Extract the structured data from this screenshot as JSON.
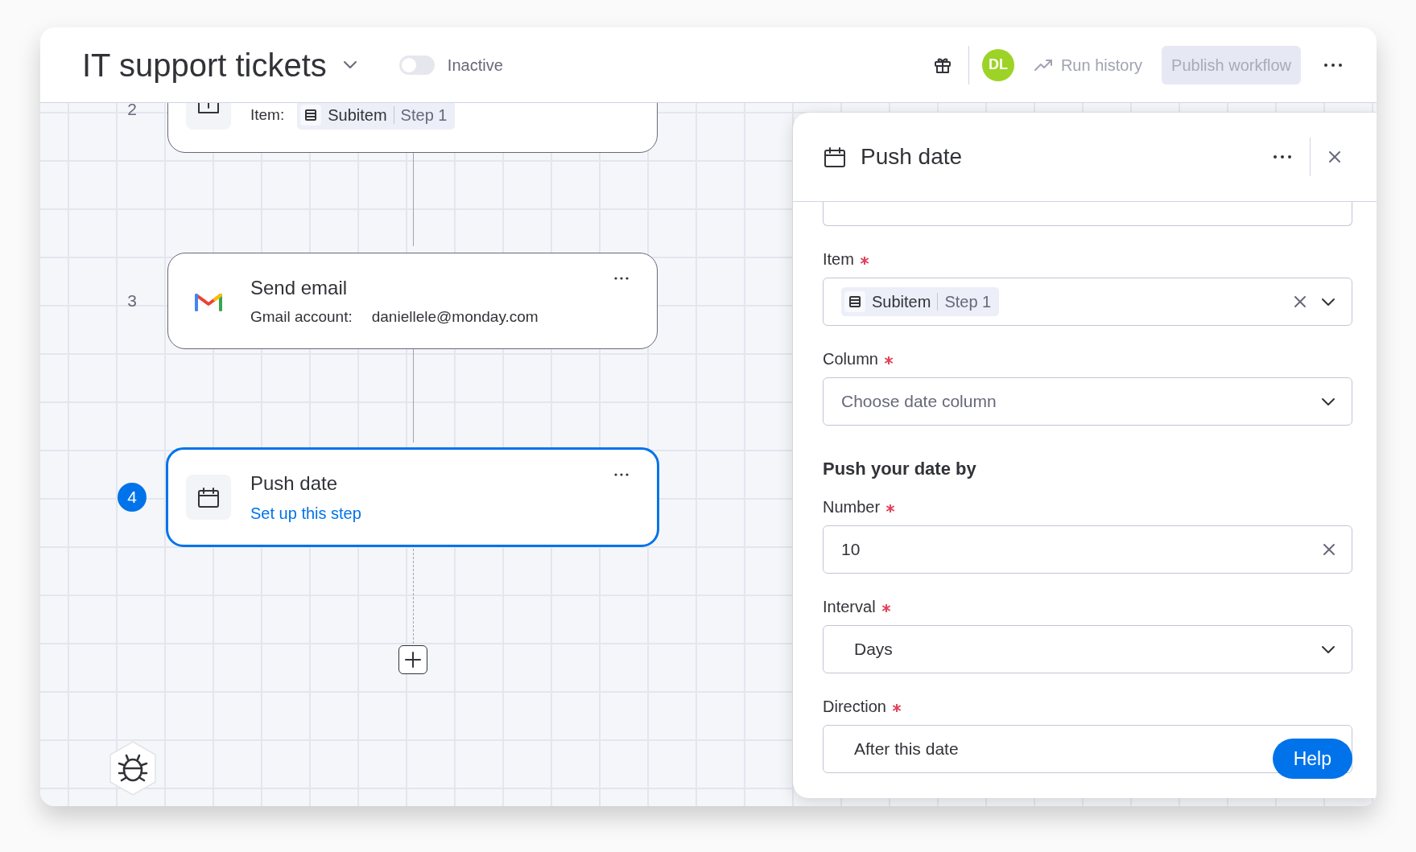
{
  "header": {
    "title": "IT support tickets",
    "toggle": {
      "on": false,
      "label": "Inactive"
    },
    "avatar": "DL",
    "run_history": "Run history",
    "publish": {
      "label": "Publish workflow",
      "disabled": true
    }
  },
  "steps": [
    {
      "number": "2",
      "selected": false,
      "kind": "item",
      "label": "Item:",
      "chip": {
        "name": "Subitem",
        "step": "Step 1"
      }
    },
    {
      "number": "3",
      "selected": false,
      "kind": "email",
      "title": "Send email",
      "label": "Gmail account:",
      "value": "daniellele@monday.com"
    },
    {
      "number": "4",
      "selected": true,
      "kind": "setup",
      "title": "Push date",
      "link": "Set up this step"
    }
  ],
  "panel": {
    "title": "Push date",
    "fields": [
      {
        "kind": "chip",
        "label": "Item",
        "required": true,
        "chip": {
          "name": "Subitem",
          "step": "Step 1"
        },
        "clearable": true,
        "chevron": true
      },
      {
        "kind": "select",
        "label": "Column",
        "required": true,
        "placeholder": "Choose date column",
        "chevron": true
      },
      {
        "kind": "heading",
        "text": "Push your date by"
      },
      {
        "kind": "input",
        "label": "Number",
        "required": true,
        "value": "10",
        "clearable": true
      },
      {
        "kind": "select",
        "label": "Interval",
        "required": true,
        "value": "Days",
        "chevron": true
      },
      {
        "kind": "select",
        "label": "Direction",
        "required": true,
        "value": "After this date",
        "chevron": false
      }
    ]
  },
  "help": "Help"
}
